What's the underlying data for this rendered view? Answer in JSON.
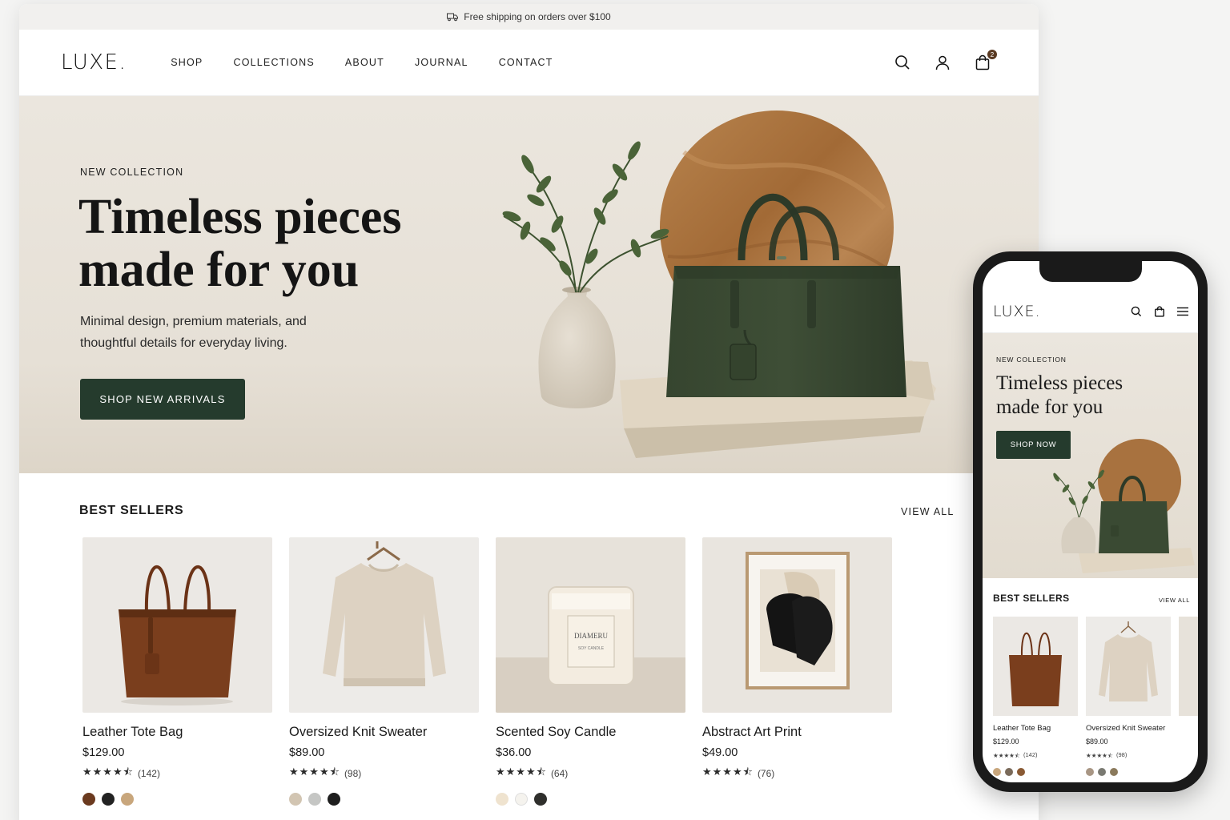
{
  "announcement": {
    "text": "Free shipping on orders over $100",
    "icon": "truck-icon"
  },
  "header": {
    "logo": "LUXE.",
    "nav": [
      "SHOP",
      "COLLECTIONS",
      "ABOUT",
      "JOURNAL",
      "CONTACT"
    ],
    "icons": [
      "search-icon",
      "account-icon",
      "bag-icon"
    ],
    "cart_count": "2"
  },
  "hero": {
    "eyebrow": "NEW COLLECTION",
    "title_line1": "Timeless pieces",
    "title_line2": "made for you",
    "subtitle": "Minimal design, premium materials, and thoughtful details for everyday living.",
    "cta": "SHOP NEW ARRIVALS"
  },
  "best_sellers": {
    "title": "BEST SELLERS",
    "view_all": "VIEW ALL",
    "products": [
      {
        "name": "Leather Tote Bag",
        "price": "$129.00",
        "stars": "★★★★⯪",
        "reviews": "(142)",
        "swatches": [
          "#6b3a1f",
          "#222222",
          "#c8a67c"
        ]
      },
      {
        "name": "Oversized Knit Sweater",
        "price": "$89.00",
        "stars": "★★★★⯪",
        "reviews": "(98)",
        "swatches": [
          "#d2c5b2",
          "#c5c6c4",
          "#1e1e1e"
        ]
      },
      {
        "name": "Scented Soy Candle",
        "price": "$36.00",
        "stars": "★★★★⯪",
        "reviews": "(64)",
        "swatches": [
          "#efe3cf",
          "#f5f3ee",
          "#2f2f2c"
        ]
      },
      {
        "name": "Abstract Art Print",
        "price": "$49.00",
        "stars": "★★★★⯪",
        "reviews": "(76)",
        "swatches": []
      }
    ]
  },
  "mobile": {
    "logo": "LUXE.",
    "icons": [
      "search-icon",
      "bag-icon",
      "menu-icon"
    ],
    "eyebrow": "NEW COLLECTION",
    "title_line1": "Timeless pieces",
    "title_line2": "made for you",
    "cta": "SHOP NOW",
    "best_sellers": "BEST SELLERS",
    "view_all": "VIEW ALL",
    "products": [
      {
        "name": "Leather Tote Bag",
        "price": "$129.00",
        "stars": "★★★★⯪",
        "reviews": "(142)",
        "swatches": [
          "#c8a67c",
          "#7a6a5a",
          "#8a5a34"
        ]
      },
      {
        "name": "Oversized Knit Sweater",
        "price": "$89.00",
        "stars": "★★★★⯪",
        "reviews": "(98)",
        "swatches": [
          "#a89684",
          "#7a7a72",
          "#8b7a5c"
        ]
      }
    ]
  },
  "colors": {
    "accent": "#253b2d",
    "hero_bg": "#e9e4dc",
    "bag_green": "#3a4a33",
    "leather": "#7a3e1d"
  }
}
